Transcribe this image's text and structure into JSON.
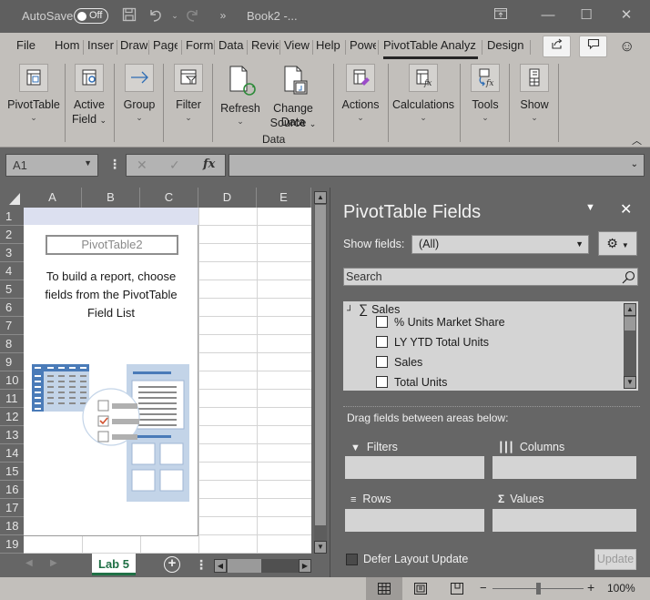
{
  "titlebar": {
    "autosave_label": "AutoSave",
    "autosave_state": "Off",
    "more_label": "»",
    "doc_title": "Book2 -..."
  },
  "tabs": [
    {
      "label": "File"
    },
    {
      "label": "Hom"
    },
    {
      "label": "Inser"
    },
    {
      "label": "Draw"
    },
    {
      "label": "Page"
    },
    {
      "label": "Form"
    },
    {
      "label": "Data"
    },
    {
      "label": "Revie"
    },
    {
      "label": "View"
    },
    {
      "label": "Help"
    },
    {
      "label": "Powe"
    },
    {
      "label": "PivotTable Analyz",
      "active": true
    },
    {
      "label": "Design"
    }
  ],
  "ribbon": {
    "pivottable": "PivotTable",
    "active_field_1": "Active",
    "active_field_2": "Field",
    "group": "Group",
    "filter": "Filter",
    "refresh": "Refresh",
    "change_data_1": "Change Data",
    "change_data_2": "Source",
    "data_group": "Data",
    "actions": "Actions",
    "calculations": "Calculations",
    "tools": "Tools",
    "show": "Show"
  },
  "formula_bar": {
    "name_box": "A1",
    "formula": ""
  },
  "grid": {
    "columns": [
      "A",
      "B",
      "C",
      "D",
      "E"
    ],
    "rows": [
      "1",
      "2",
      "3",
      "4",
      "5",
      "6",
      "7",
      "8",
      "9",
      "10",
      "11",
      "12",
      "13",
      "14",
      "15",
      "16",
      "17",
      "18",
      "19"
    ],
    "pivot_name": "PivotTable2",
    "pivot_message": "To build a report, choose fields from the PivotTable Field List"
  },
  "sheets": {
    "active": "Lab 5"
  },
  "status": {
    "zoom": "100%"
  },
  "pane": {
    "title": "PivotTable Fields",
    "show_fields_label": "Show fields:",
    "show_fields_value": "(All)",
    "search_placeholder": "Search",
    "group_name": "Sales",
    "fields": [
      {
        "label": "% Units Market Share",
        "checked": false
      },
      {
        "label": "LY YTD Total Units",
        "checked": false
      },
      {
        "label": "Sales",
        "checked": false
      },
      {
        "label": "Total Units",
        "checked": false
      }
    ],
    "drag_label": "Drag fields between areas below:",
    "filters": "Filters",
    "columns": "Columns",
    "rows": "Rows",
    "values": "Values",
    "defer_label": "Defer Layout Update",
    "update_label": "Update"
  }
}
